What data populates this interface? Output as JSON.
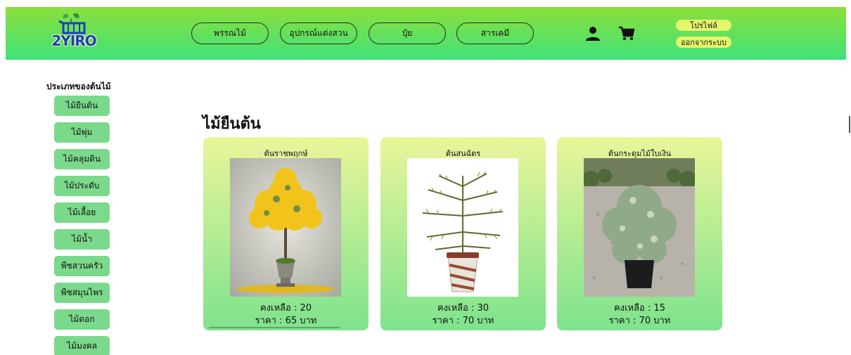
{
  "header": {
    "logo_text": "2YIRO",
    "nav": [
      {
        "label": "พรรณไม้"
      },
      {
        "label": "อุปกรณ์แต่งสวน"
      },
      {
        "label": "ปุ๋ย"
      },
      {
        "label": "สารเคมี"
      }
    ],
    "profile_label": "โปรไฟล์",
    "logout_label": "ออกจากระบบ",
    "icons": {
      "user": "user-icon",
      "cart": "cart-icon"
    },
    "colors": {
      "gradient_top": "#8be03a",
      "gradient_bottom": "#3fe27a",
      "pill": "#e6f56a"
    }
  },
  "sidebar": {
    "title": "ประเภทของต้นไม้",
    "items": [
      {
        "label": "ไม้ยืนต้น"
      },
      {
        "label": "ไม้พุ่ม"
      },
      {
        "label": "ไม้คลุมดิน"
      },
      {
        "label": "ไม้ประดับ"
      },
      {
        "label": "ไม้เลื้อย"
      },
      {
        "label": "ไม้น้ำ"
      },
      {
        "label": "พืชสวนครัว"
      },
      {
        "label": "พืชสมุนไพร"
      },
      {
        "label": "ไม้ดอก"
      },
      {
        "label": "ไม้มงคล"
      }
    ],
    "color": "#7ad98a"
  },
  "main": {
    "title": "ไม้ยืนต้น",
    "cards": [
      {
        "name": "ต้นราชพฤกษ์",
        "stock": "คงเหลือ : 20",
        "price": "ราคา : 65 บาท"
      },
      {
        "name": "ต้นสนฉัตร",
        "stock": "คงเหลือ : 30",
        "price": "ราคา : 70 บาท"
      },
      {
        "name": "ต้นกระดุมไม้ใบเงิน",
        "stock": "คงเหลือ : 15",
        "price": "ราคา : 70 บาท"
      }
    ]
  }
}
